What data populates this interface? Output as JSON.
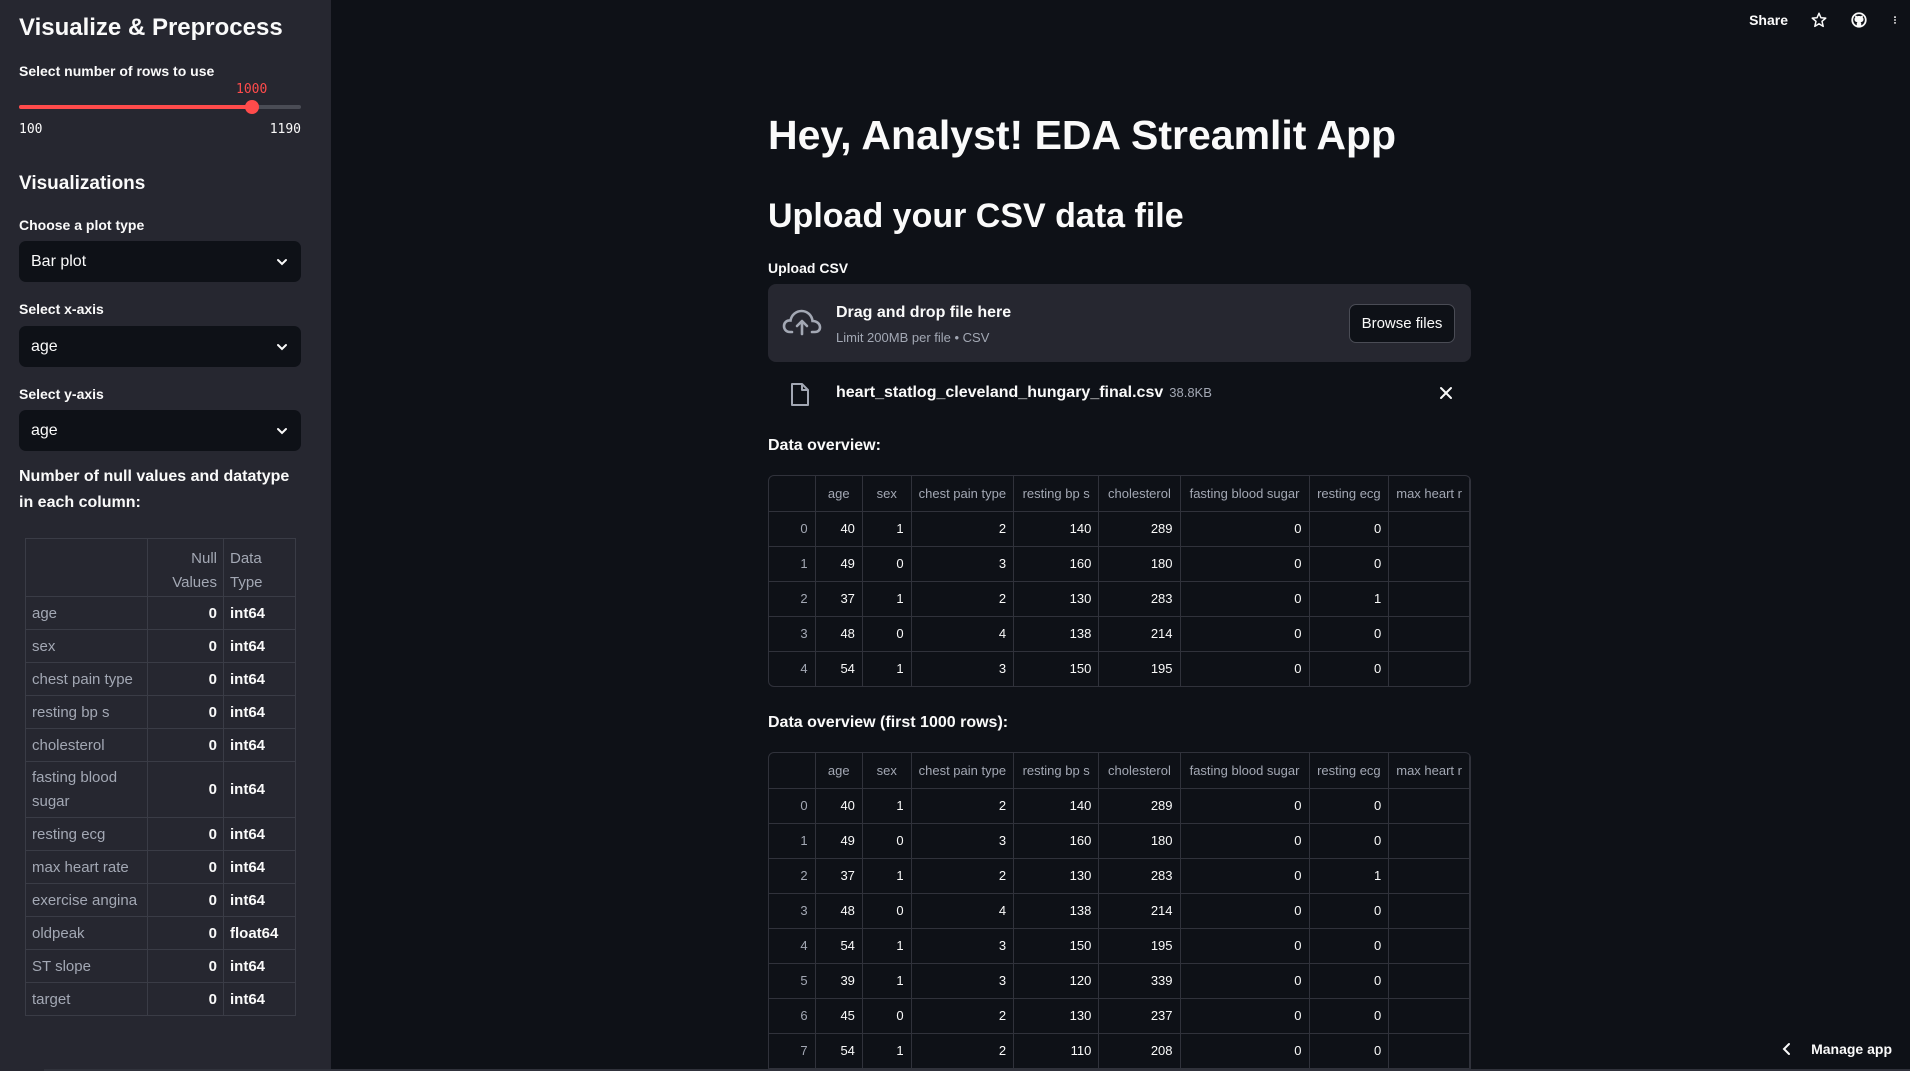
{
  "sidebar": {
    "title": "Visualize & Preprocess",
    "rows_label": "Select number of rows to use",
    "slider": {
      "value": "1000",
      "min": "100",
      "max": "1190",
      "value_num": 1000,
      "min_num": 100,
      "max_num": 1190
    },
    "visualizations_heading": "Visualizations",
    "plot_type_label": "Choose a plot type",
    "plot_type_value": "Bar plot",
    "x_axis_label": "Select x-axis",
    "x_axis_value": "age",
    "y_axis_label": "Select y-axis",
    "y_axis_value": "age",
    "null_title": "Number of null values and datatype in each column:",
    "null_table": {
      "headers": [
        "Null Values",
        "Data Type"
      ],
      "rows": [
        {
          "col": "age",
          "nulls": "0",
          "dtype": "int64"
        },
        {
          "col": "sex",
          "nulls": "0",
          "dtype": "int64"
        },
        {
          "col": "chest pain type",
          "nulls": "0",
          "dtype": "int64"
        },
        {
          "col": "resting bp s",
          "nulls": "0",
          "dtype": "int64"
        },
        {
          "col": "cholesterol",
          "nulls": "0",
          "dtype": "int64"
        },
        {
          "col": "fasting blood sugar",
          "nulls": "0",
          "dtype": "int64"
        },
        {
          "col": "resting ecg",
          "nulls": "0",
          "dtype": "int64"
        },
        {
          "col": "max heart rate",
          "nulls": "0",
          "dtype": "int64"
        },
        {
          "col": "exercise angina",
          "nulls": "0",
          "dtype": "int64"
        },
        {
          "col": "oldpeak",
          "nulls": "0",
          "dtype": "float64"
        },
        {
          "col": "ST slope",
          "nulls": "0",
          "dtype": "int64"
        },
        {
          "col": "target",
          "nulls": "0",
          "dtype": "int64"
        }
      ]
    }
  },
  "header": {
    "share_label": "Share"
  },
  "main": {
    "title": "Hey, Analyst! EDA Streamlit App",
    "upload_heading": "Upload your CSV data file",
    "upload_label": "Upload CSV",
    "uploader": {
      "title": "Drag and drop file here",
      "subtitle": "Limit 200MB per file • CSV",
      "browse_label": "Browse files"
    },
    "file": {
      "name": "heart_statlog_cleveland_hungary_final.csv",
      "size": "38.8KB"
    },
    "overview_label": "Data overview:",
    "overview_rows_label": "Data overview (first 1000 rows):",
    "columns": [
      "age",
      "sex",
      "chest pain type",
      "resting bp s",
      "cholesterol",
      "fasting blood sugar",
      "resting ecg",
      "max heart r"
    ],
    "rows": [
      [
        "0",
        "40",
        "1",
        "2",
        "140",
        "289",
        "0",
        "0",
        ""
      ],
      [
        "1",
        "49",
        "0",
        "3",
        "160",
        "180",
        "0",
        "0",
        ""
      ],
      [
        "2",
        "37",
        "1",
        "2",
        "130",
        "283",
        "0",
        "1",
        ""
      ],
      [
        "3",
        "48",
        "0",
        "4",
        "138",
        "214",
        "0",
        "0",
        ""
      ],
      [
        "4",
        "54",
        "1",
        "3",
        "150",
        "195",
        "0",
        "0",
        ""
      ],
      [
        "5",
        "39",
        "1",
        "3",
        "120",
        "339",
        "0",
        "0",
        ""
      ],
      [
        "6",
        "45",
        "0",
        "2",
        "130",
        "237",
        "0",
        "0",
        ""
      ],
      [
        "7",
        "54",
        "1",
        "2",
        "110",
        "208",
        "0",
        "0",
        ""
      ]
    ]
  },
  "footer": {
    "manage_label": "Manage app"
  },
  "colors": {
    "accent": "#ff4b4b",
    "background": "#0e1117",
    "sidebar": "#262730"
  }
}
